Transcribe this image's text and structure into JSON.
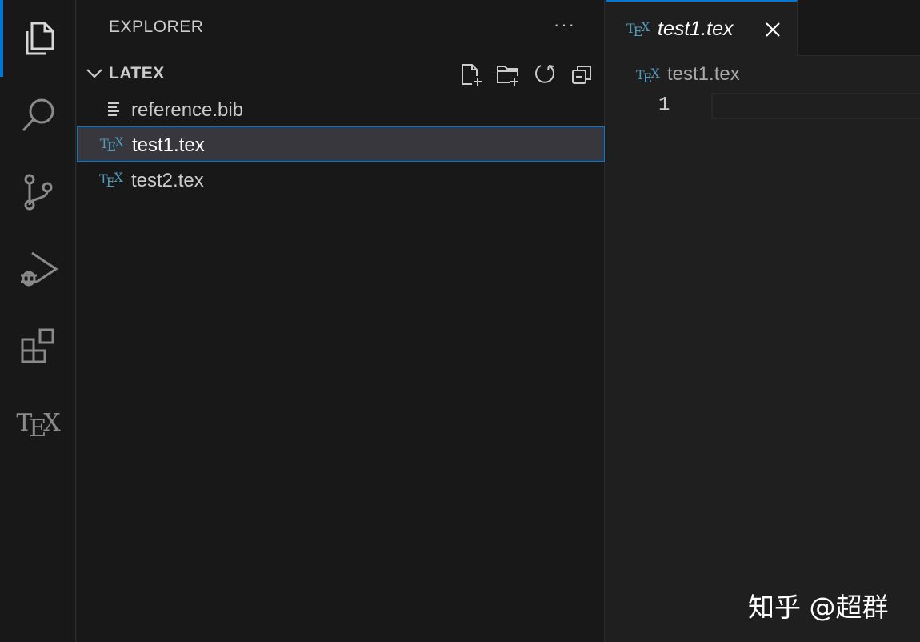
{
  "activity_bar": {
    "items": [
      {
        "name": "explorer",
        "icon": "files-icon",
        "active": true
      },
      {
        "name": "search",
        "icon": "search-icon"
      },
      {
        "name": "source-control",
        "icon": "source-control-icon"
      },
      {
        "name": "run-debug",
        "icon": "run-debug-icon"
      },
      {
        "name": "extensions",
        "icon": "extensions-icon"
      },
      {
        "name": "tex",
        "icon": "tex-icon"
      }
    ],
    "tex_logo": {
      "t": "T",
      "e": "E",
      "x": "X"
    }
  },
  "sidebar": {
    "title": "EXPLORER",
    "more": "···",
    "section": {
      "title": "LATEX",
      "actions": [
        "new-file-icon",
        "new-folder-icon",
        "refresh-icon",
        "collapse-all-icon"
      ]
    },
    "files": [
      {
        "name": "reference.bib",
        "icon": "lines-icon"
      },
      {
        "name": "test1.tex",
        "icon": "tex-file-icon",
        "selected": true
      },
      {
        "name": "test2.tex",
        "icon": "tex-file-icon"
      }
    ],
    "tex_file_icon": {
      "t": "T",
      "e": "E",
      "x": "X"
    }
  },
  "editor": {
    "tab": {
      "label": "test1.tex",
      "italic": true
    },
    "breadcrumb": {
      "label": "test1.tex"
    },
    "line_numbers": [
      "1"
    ]
  },
  "watermark": "知乎 @超群",
  "colors": {
    "accent": "#0078d4",
    "tex_icon": "#519aba",
    "background": "#181818",
    "editor_background": "#1f1f1f"
  }
}
